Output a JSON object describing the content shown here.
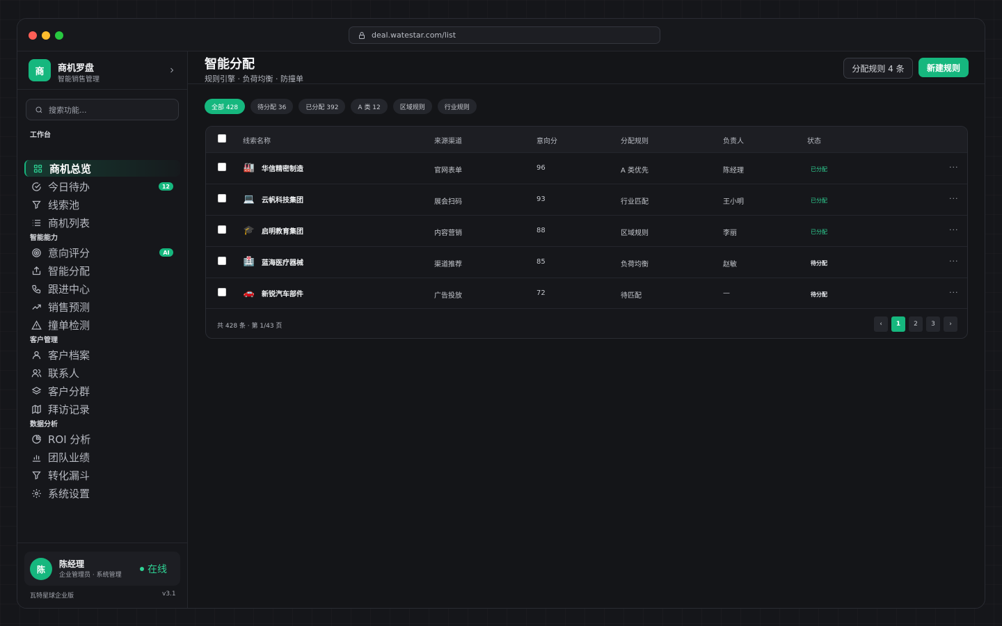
{
  "browser": {
    "url": "deal.watestar.com/list"
  },
  "brand": {
    "logo_char": "商",
    "title": "商机罗盘",
    "subtitle": "智能销售管理"
  },
  "search": {
    "placeholder": "搜索功能..."
  },
  "sidebar": {
    "sections": [
      {
        "label": "工作台"
      },
      {
        "label": "智能能力"
      },
      {
        "label": "客户管理"
      },
      {
        "label": "数据分析"
      }
    ],
    "items": [
      {
        "label": "商机总览",
        "icon": "grid-icon",
        "active": true
      },
      {
        "label": "今日待办",
        "icon": "check-circle-icon",
        "badge": "12"
      },
      {
        "label": "线索池",
        "icon": "filter-icon"
      },
      {
        "label": "商机列表",
        "icon": "list-icon"
      },
      {
        "label": "意向评分",
        "icon": "target-icon",
        "badge": "AI"
      },
      {
        "label": "智能分配",
        "icon": "share-icon"
      },
      {
        "label": "跟进中心",
        "icon": "phone-icon"
      },
      {
        "label": "销售预测",
        "icon": "trending-up-icon"
      },
      {
        "label": "撞单检测",
        "icon": "alert-triangle-icon"
      },
      {
        "label": "客户档案",
        "icon": "user-icon"
      },
      {
        "label": "联系人",
        "icon": "users-icon"
      },
      {
        "label": "客户分群",
        "icon": "layers-icon"
      },
      {
        "label": "拜访记录",
        "icon": "map-icon"
      },
      {
        "label": "ROI 分析",
        "icon": "pie-chart-icon"
      },
      {
        "label": "团队业绩",
        "icon": "bar-chart-icon"
      },
      {
        "label": "转化漏斗",
        "icon": "funnel-icon"
      },
      {
        "label": "系统设置",
        "icon": "gear-icon"
      }
    ]
  },
  "user": {
    "avatar_char": "陈",
    "name": "陈经理",
    "role": "企业管理员 · 系统管理",
    "status": "在线"
  },
  "footer": {
    "org": "瓦特星球企业版",
    "version": "v3.1"
  },
  "page": {
    "title": "智能分配",
    "subtitle": "规则引擎 · 负荷均衡 · 防撞单",
    "rules_button": "分配规则 4 条",
    "new_button": "新建规则"
  },
  "filters": [
    "全部 428",
    "待分配 36",
    "已分配 392",
    "A 类 12",
    "区域规则",
    "行业规则"
  ],
  "table": {
    "headers": [
      "线索名称",
      "来源渠道",
      "意向分",
      "分配规则",
      "负责人",
      "状态"
    ],
    "rows": [
      {
        "icon": "🏭",
        "name": "华信精密制造",
        "source": "官网表单",
        "score": "96",
        "rule": "A 类优先",
        "owner": "陈经理",
        "status": "已分配",
        "assigned": true
      },
      {
        "icon": "💻",
        "name": "云帆科技集团",
        "source": "展会扫码",
        "score": "93",
        "rule": "行业匹配",
        "owner": "王小明",
        "status": "已分配",
        "assigned": true
      },
      {
        "icon": "🎓",
        "name": "启明教育集团",
        "source": "内容营销",
        "score": "88",
        "rule": "区域规则",
        "owner": "李丽",
        "status": "已分配",
        "assigned": true
      },
      {
        "icon": "🏥",
        "name": "蓝海医疗器械",
        "source": "渠道推荐",
        "score": "85",
        "rule": "负荷均衡",
        "owner": "赵敏",
        "status": "待分配",
        "assigned": false
      },
      {
        "icon": "🚗",
        "name": "新锐汽车部件",
        "source": "广告投放",
        "score": "72",
        "rule": "待匹配",
        "owner": "—",
        "status": "待分配",
        "assigned": false
      }
    ],
    "footer_text": "共 428 条 · 第 1/43 页",
    "pages": [
      "‹",
      "1",
      "2",
      "3",
      "›"
    ],
    "current_page": "1"
  },
  "colors": {
    "accent": "#16b77e",
    "status_green": "#2fd395"
  }
}
